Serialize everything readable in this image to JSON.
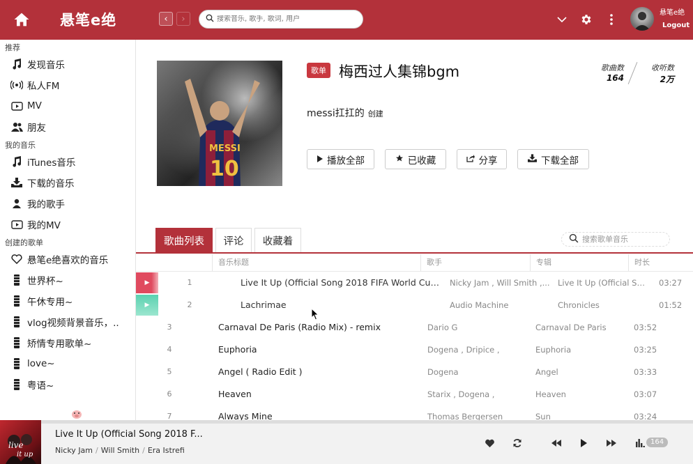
{
  "header": {
    "app_title": "悬笔e绝",
    "search_placeholder": "搜索音乐, 歌手, 歌词, 用户",
    "user_name": "悬笔e绝",
    "logout_label": "Logout"
  },
  "sidebar": {
    "sections": [
      {
        "title": "推荐",
        "items": [
          {
            "label": "发现音乐",
            "icon": "music-note-icon"
          },
          {
            "label": "私人FM",
            "icon": "radio-icon"
          },
          {
            "label": "MV",
            "icon": "video-icon"
          },
          {
            "label": "朋友",
            "icon": "friends-icon"
          }
        ]
      },
      {
        "title": "我的音乐",
        "items": [
          {
            "label": "iTunes音乐",
            "icon": "music-note-icon"
          },
          {
            "label": "下载的音乐",
            "icon": "download-icon"
          },
          {
            "label": "我的歌手",
            "icon": "person-icon"
          },
          {
            "label": "我的MV",
            "icon": "video-icon"
          }
        ]
      },
      {
        "title": "创建的歌单",
        "items": [
          {
            "label": "悬笔e绝喜欢的音乐",
            "icon": "heart-icon"
          },
          {
            "label": "世界杯~",
            "icon": "playlist-icon"
          },
          {
            "label": "午休专用~",
            "icon": "playlist-icon"
          },
          {
            "label": "vlog视频背景音乐，..",
            "icon": "playlist-icon"
          },
          {
            "label": "矫情专用歌单~",
            "icon": "playlist-icon"
          },
          {
            "label": "love~",
            "icon": "playlist-icon"
          },
          {
            "label": "粤语~",
            "icon": "playlist-icon"
          }
        ]
      }
    ]
  },
  "playlist": {
    "tag": "歌单",
    "title": "梅西过人集锦bgm",
    "creator": "messi扛扛的",
    "created_label": "创建",
    "song_count_label": "歌曲数",
    "song_count": "164",
    "listen_count_label": "收听数",
    "listen_count": "2万",
    "buttons": {
      "play_all": "播放全部",
      "collected": "已收藏",
      "share": "分享",
      "download_all": "下载全部"
    }
  },
  "tabs": [
    {
      "label": "歌曲列表",
      "active": true
    },
    {
      "label": "评论",
      "active": false
    },
    {
      "label": "收藏着",
      "active": false
    }
  ],
  "list_search_placeholder": "搜索歌单音乐",
  "table": {
    "columns": [
      "音乐标题",
      "歌手",
      "专辑",
      "时长"
    ],
    "rows": [
      {
        "num": "1",
        "title": "Live It Up (Official Song 2018 FIFA World Cup Ru..",
        "artist": "Nicky Jam , Will Smith ,...",
        "album": "Live It Up (Official Son...",
        "duration": "03:27",
        "state": "playing"
      },
      {
        "num": "2",
        "title": "Lachrimae",
        "artist": "Audio Machine",
        "album": "Chronicles",
        "duration": "01:52",
        "state": "queued"
      },
      {
        "num": "3",
        "title": "Carnaval De Paris (Radio Mix) - remix",
        "artist": "Dario G",
        "album": "Carnaval De Paris",
        "duration": "03:52",
        "state": ""
      },
      {
        "num": "4",
        "title": "Euphoria",
        "artist": "Dogena , Dripice ,",
        "album": "Euphoria",
        "duration": "03:25",
        "state": ""
      },
      {
        "num": "5",
        "title": "Angel ( Radio Edit )",
        "artist": "Dogena",
        "album": "Angel",
        "duration": "03:33",
        "state": ""
      },
      {
        "num": "6",
        "title": "Heaven",
        "artist": "Starix , Dogena ,",
        "album": "Heaven",
        "duration": "03:07",
        "state": ""
      },
      {
        "num": "7",
        "title": "Always Mine",
        "artist": "Thomas Bergersen",
        "album": "Sun",
        "duration": "03:24",
        "state": ""
      }
    ]
  },
  "player": {
    "title": "Live It Up (Official Song 2018 F...",
    "artists": [
      "Nicky Jam",
      "Will Smith",
      "Era Istrefi"
    ],
    "queue_count": "164"
  },
  "colors": {
    "brand": "#b3313a",
    "playing_row": "#e04a5f",
    "queued_row": "#5bd1b0"
  }
}
